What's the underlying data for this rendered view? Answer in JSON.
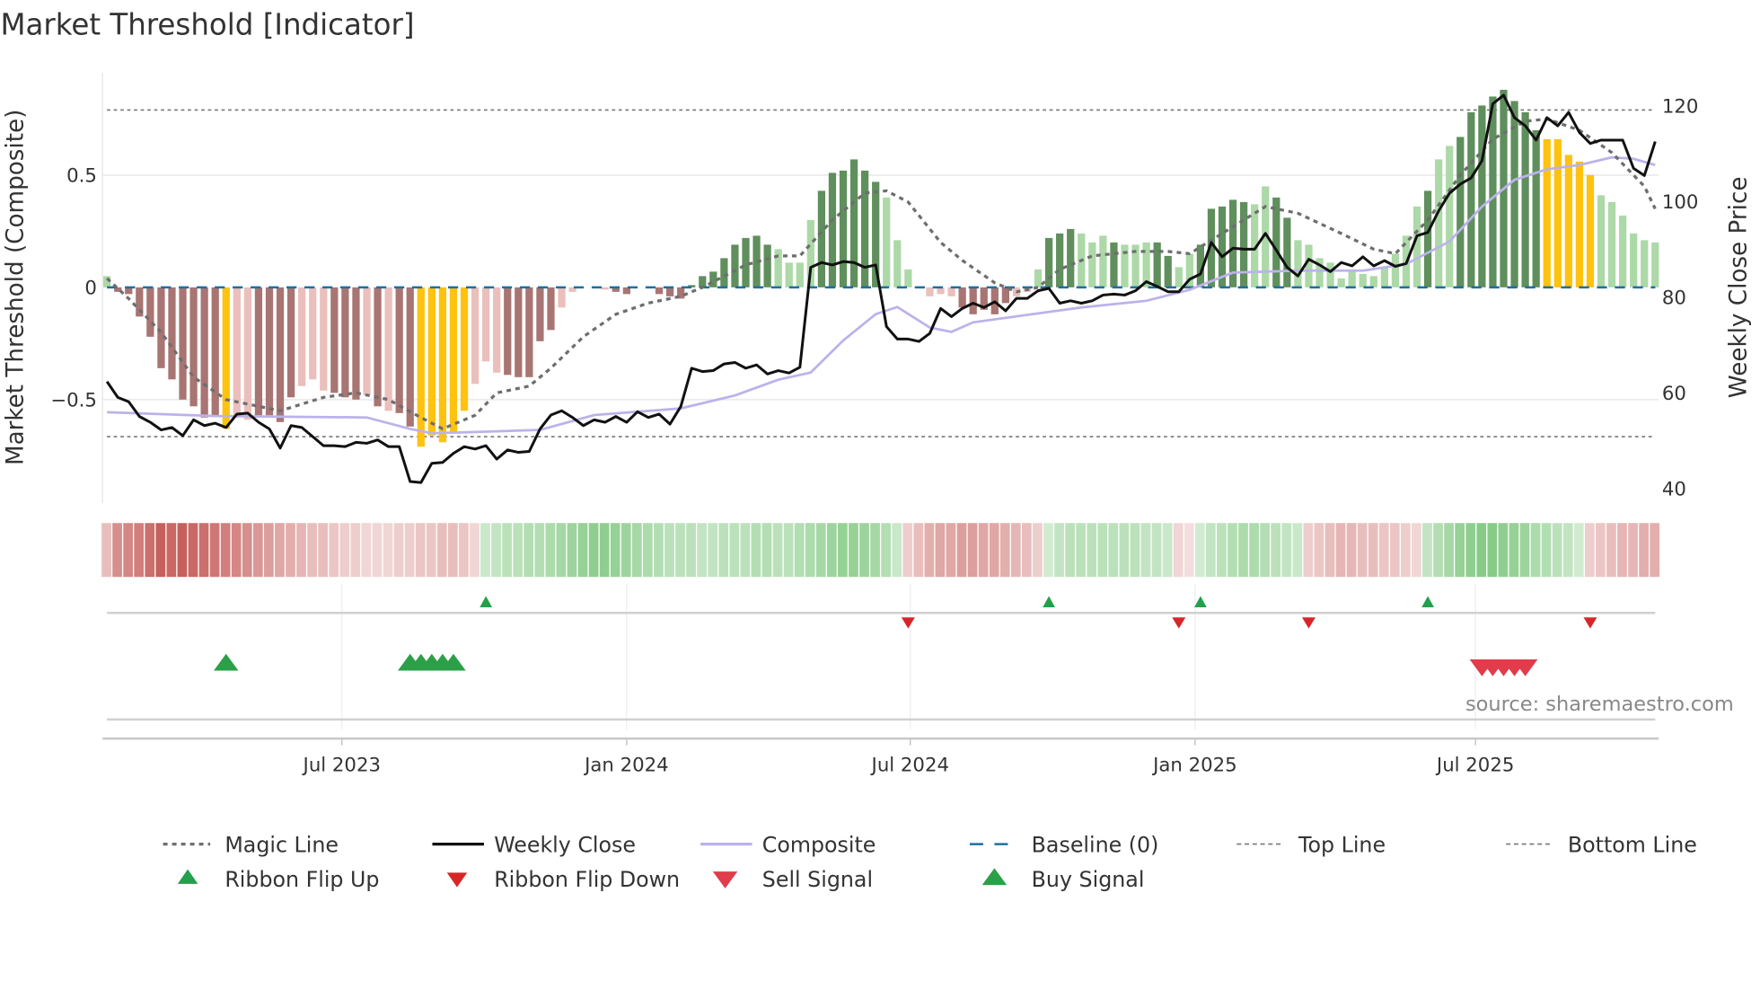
{
  "title": "Market Threshold [Indicator]",
  "source": "source: sharemaestro.com",
  "colors": {
    "bar_dark_green": "#5f8f5c",
    "bar_light_green": "#acd9a7",
    "bar_dark_red": "#a87572",
    "bar_light_red": "#ebbfbb",
    "bar_signal": "#ffc20e",
    "weekly_close": "#111111",
    "composite": "#bcb2ea",
    "magic": "#6e6e6e",
    "baseline": "#1f6f9f",
    "ribbon_red": "#c0504d",
    "ribbon_green": "#5cb85c",
    "flip_up": "#22a04b",
    "flip_down": "#d62728",
    "buy": "#2ca048",
    "sell": "#e03c4c"
  },
  "chart_data": {
    "type": "bar+line",
    "title": "Market Threshold [Indicator]",
    "ylabel_left": "Market Threshold (Composite)",
    "ylabel_right": "Weekly Close Price",
    "ylim_left": [
      -0.955,
      0.955
    ],
    "ylim_right": [
      36,
      124
    ],
    "left_ticks": [
      {
        "v": 0.5,
        "label": "0.5"
      },
      {
        "v": 0,
        "label": "0"
      },
      {
        "v": -0.5,
        "label": "−0.5"
      }
    ],
    "right_ticks": [
      {
        "v": 120,
        "label": "120"
      },
      {
        "v": 100,
        "label": "100"
      },
      {
        "v": 80,
        "label": "80"
      },
      {
        "v": 60,
        "label": "60"
      },
      {
        "v": 40,
        "label": "40"
      }
    ],
    "x_ticks": [
      {
        "week": 21.7,
        "label": "Jul 2023"
      },
      {
        "week": 48.0,
        "label": "Jan 2024"
      },
      {
        "week": 74.2,
        "label": "Jul 2024"
      },
      {
        "week": 100.5,
        "label": "Jan 2025"
      },
      {
        "week": 126.4,
        "label": "Jul 2025"
      }
    ],
    "top_line": 0.79,
    "bottom_line": -0.665,
    "baseline": 0,
    "composite_bars": [
      0.05,
      -0.02,
      -0.03,
      -0.13,
      -0.22,
      -0.36,
      -0.41,
      -0.5,
      -0.53,
      -0.58,
      -0.57,
      -0.63,
      -0.58,
      -0.59,
      -0.57,
      -0.57,
      -0.6,
      -0.49,
      -0.44,
      -0.41,
      -0.46,
      -0.47,
      -0.49,
      -0.5,
      -0.48,
      -0.53,
      -0.55,
      -0.56,
      -0.62,
      -0.71,
      -0.66,
      -0.69,
      -0.65,
      -0.55,
      -0.43,
      -0.33,
      -0.38,
      -0.39,
      -0.4,
      -0.4,
      -0.24,
      -0.19,
      -0.09,
      -0.02,
      0,
      0,
      -0.01,
      -0.02,
      -0.03,
      0,
      0,
      -0.03,
      -0.04,
      -0.05,
      0.01,
      0.05,
      0.07,
      0.13,
      0.19,
      0.22,
      0.23,
      0.19,
      0.17,
      0.11,
      0.11,
      0.3,
      0.43,
      0.51,
      0.52,
      0.57,
      0.52,
      0.47,
      0.4,
      0.21,
      0.08,
      0,
      -0.04,
      -0.03,
      -0.04,
      -0.09,
      -0.12,
      -0.1,
      -0.12,
      -0.07,
      -0.04,
      -0.02,
      0.08,
      0.22,
      0.24,
      0.26,
      0.24,
      0.2,
      0.23,
      0.2,
      0.19,
      0.19,
      0.2,
      0.2,
      0.14,
      0.09,
      0.15,
      0.19,
      0.35,
      0.36,
      0.39,
      0.38,
      0.37,
      0.45,
      0.4,
      0.31,
      0.21,
      0.19,
      0.13,
      0.11,
      0.04,
      0.08,
      0.06,
      0.05,
      0.09,
      0.15,
      0.23,
      0.36,
      0.43,
      0.57,
      0.63,
      0.67,
      0.78,
      0.81,
      0.85,
      0.88,
      0.83,
      0.78,
      0.7,
      0.66,
      0.66,
      0.59,
      0.56,
      0.5,
      0.41,
      0.38,
      0.32,
      0.24,
      0.21,
      0.2
    ],
    "bar_kind": "lddddddddddgllddddllldddldlddgggggllldddddlllllddlldddddddddddllllddddddllllllldddddllldddllldlllddlldddddllddlllllllllllldllddddddddgggggllllllllllll",
    "weekly_close": [
      62.4,
      59.1,
      58.2,
      55.1,
      53.9,
      52.3,
      52.8,
      51.1,
      54.4,
      53.2,
      53.7,
      52.8,
      55.6,
      55.8,
      53.9,
      52.5,
      48.5,
      53.2,
      52.8,
      50.9,
      49.0,
      49.0,
      48.8,
      49.7,
      49.5,
      50.2,
      48.8,
      48.8,
      41.5,
      41.3,
      45.3,
      45.5,
      47.4,
      48.8,
      48.3,
      49.0,
      46.2,
      48.1,
      47.6,
      47.8,
      52.5,
      55.4,
      56.3,
      54.9,
      53.2,
      54.4,
      53.9,
      55.1,
      53.9,
      56.1,
      54.9,
      55.6,
      53.5,
      57.2,
      65.2,
      64.5,
      64.7,
      66.1,
      66.4,
      65.2,
      65.9,
      64.0,
      64.7,
      64.2,
      65.4,
      86.3,
      87.3,
      86.8,
      87.5,
      87.3,
      86.3,
      86.8,
      73.9,
      71.3,
      71.3,
      70.8,
      72.5,
      77.7,
      76.0,
      77.7,
      78.8,
      77.9,
      79.1,
      77.2,
      79.8,
      79.8,
      81.4,
      81.9,
      78.8,
      79.3,
      78.8,
      79.3,
      80.5,
      80.7,
      80.5,
      81.4,
      83.3,
      82.3,
      81.2,
      81.2,
      83.8,
      84.9,
      91.5,
      88.5,
      90.3,
      90.1,
      90.1,
      93.4,
      89.9,
      86.3,
      84.5,
      88.0,
      86.8,
      85.4,
      87.3,
      86.6,
      88.5,
      86.6,
      87.7,
      86.5,
      87.1,
      92.9,
      93.6,
      98.1,
      101.8,
      103.7,
      105.0,
      108.6,
      120.5,
      122.3,
      117.6,
      115.9,
      112.9,
      117.6,
      115.9,
      118.7,
      114.5,
      112.2,
      112.9,
      112.9,
      112.9,
      107.0,
      105.5,
      112.6
    ],
    "composite_line": [
      [
        0,
        56.0
      ],
      [
        10,
        55.2
      ],
      [
        24,
        54.9
      ],
      [
        28,
        52.5
      ],
      [
        30,
        51.6
      ],
      [
        36,
        52.0
      ],
      [
        40,
        52.3
      ],
      [
        45,
        55.4
      ],
      [
        53,
        56.8
      ],
      [
        58,
        59.5
      ],
      [
        62,
        62.8
      ],
      [
        65,
        64.3
      ],
      [
        68,
        71.0
      ],
      [
        71,
        76.5
      ],
      [
        73,
        78.0
      ],
      [
        76,
        73.7
      ],
      [
        78,
        72.8
      ],
      [
        80,
        74.8
      ],
      [
        90,
        77.9
      ],
      [
        96,
        79.3
      ],
      [
        100,
        81.6
      ],
      [
        104,
        85.2
      ],
      [
        110,
        85.6
      ],
      [
        116,
        85.6
      ],
      [
        120,
        87.0
      ],
      [
        124,
        91.7
      ],
      [
        127,
        99.0
      ],
      [
        130,
        104.6
      ],
      [
        133,
        106.8
      ],
      [
        136,
        107.7
      ],
      [
        139,
        109.3
      ],
      [
        141,
        109.0
      ],
      [
        143,
        107.7
      ]
    ],
    "magic_line": [
      [
        0,
        0.04
      ],
      [
        2,
        -0.05
      ],
      [
        5,
        -0.2
      ],
      [
        8,
        -0.4
      ],
      [
        11,
        -0.5
      ],
      [
        14,
        -0.53
      ],
      [
        16,
        -0.55
      ],
      [
        20,
        -0.49
      ],
      [
        23,
        -0.47
      ],
      [
        26,
        -0.5
      ],
      [
        29,
        -0.58
      ],
      [
        31,
        -0.63
      ],
      [
        34,
        -0.57
      ],
      [
        36,
        -0.47
      ],
      [
        39,
        -0.44
      ],
      [
        41,
        -0.36
      ],
      [
        44,
        -0.22
      ],
      [
        47,
        -0.12
      ],
      [
        50,
        -0.07
      ],
      [
        53,
        -0.04
      ],
      [
        55,
        0.0
      ],
      [
        59,
        0.1
      ],
      [
        62,
        0.14
      ],
      [
        64,
        0.14
      ],
      [
        67,
        0.3
      ],
      [
        70,
        0.42
      ],
      [
        72,
        0.43
      ],
      [
        74,
        0.38
      ],
      [
        77,
        0.2
      ],
      [
        79,
        0.12
      ],
      [
        82,
        0.02
      ],
      [
        84,
        -0.02
      ],
      [
        86,
        0.0
      ],
      [
        88,
        0.08
      ],
      [
        91,
        0.14
      ],
      [
        95,
        0.16
      ],
      [
        98,
        0.16
      ],
      [
        100,
        0.15
      ],
      [
        103,
        0.24
      ],
      [
        107,
        0.36
      ],
      [
        110,
        0.33
      ],
      [
        114,
        0.24
      ],
      [
        117,
        0.17
      ],
      [
        119,
        0.15
      ],
      [
        122,
        0.3
      ],
      [
        125,
        0.5
      ],
      [
        128,
        0.66
      ],
      [
        131,
        0.74
      ],
      [
        133,
        0.75
      ],
      [
        136,
        0.7
      ],
      [
        139,
        0.6
      ],
      [
        142,
        0.45
      ],
      [
        143,
        0.35
      ]
    ],
    "ribbon": [
      -0.3,
      -0.6,
      -0.65,
      -0.7,
      -0.8,
      -0.9,
      -0.85,
      -0.9,
      -0.85,
      -0.8,
      -0.75,
      -0.7,
      -0.65,
      -0.6,
      -0.55,
      -0.5,
      -0.45,
      -0.4,
      -0.35,
      -0.3,
      -0.3,
      -0.25,
      -0.2,
      -0.2,
      -0.15,
      -0.15,
      -0.15,
      -0.2,
      -0.2,
      -0.25,
      -0.25,
      -0.3,
      -0.3,
      -0.25,
      -0.15,
      0.2,
      0.25,
      0.3,
      0.3,
      0.35,
      0.35,
      0.4,
      0.45,
      0.5,
      0.55,
      0.6,
      0.6,
      0.55,
      0.5,
      0.45,
      0.4,
      0.35,
      0.3,
      0.3,
      0.3,
      0.25,
      0.25,
      0.3,
      0.3,
      0.3,
      0.35,
      0.35,
      0.3,
      0.3,
      0.35,
      0.4,
      0.45,
      0.5,
      0.55,
      0.55,
      0.5,
      0.45,
      0.35,
      0.2,
      -0.2,
      -0.3,
      -0.4,
      -0.45,
      -0.45,
      -0.5,
      -0.5,
      -0.45,
      -0.45,
      -0.4,
      -0.35,
      -0.3,
      -0.2,
      0.15,
      0.25,
      0.3,
      0.3,
      0.3,
      0.3,
      0.3,
      0.3,
      0.3,
      0.25,
      0.25,
      0.2,
      -0.15,
      -0.1,
      0.15,
      0.25,
      0.3,
      0.35,
      0.4,
      0.4,
      0.35,
      0.3,
      0.25,
      0.2,
      -0.2,
      -0.25,
      -0.3,
      -0.35,
      -0.35,
      -0.3,
      -0.3,
      -0.25,
      -0.25,
      -0.2,
      -0.15,
      0.25,
      0.35,
      0.45,
      0.55,
      0.6,
      0.65,
      0.65,
      0.6,
      0.55,
      0.5,
      0.4,
      0.35,
      0.3,
      0.25,
      0.15,
      -0.2,
      -0.25,
      -0.3,
      -0.35,
      -0.35,
      -0.4,
      -0.4
    ],
    "ribbon_flip_up": [
      35,
      87,
      101,
      122
    ],
    "ribbon_flip_down": [
      74,
      99,
      111,
      137
    ],
    "buy_signals": [
      11,
      28,
      29,
      30,
      31,
      32
    ],
    "sell_signals": [
      127,
      128,
      129,
      130,
      131
    ],
    "legend": [
      {
        "key": "magic",
        "label": "Magic Line"
      },
      {
        "key": "close",
        "label": "Weekly Close"
      },
      {
        "key": "composite",
        "label": "Composite"
      },
      {
        "key": "baseline",
        "label": "Baseline (0)"
      },
      {
        "key": "top",
        "label": "Top Line"
      },
      {
        "key": "bottom",
        "label": "Bottom Line"
      },
      {
        "key": "flip_up",
        "label": "Ribbon Flip Up"
      },
      {
        "key": "flip_down",
        "label": "Ribbon Flip Down"
      },
      {
        "key": "sell",
        "label": "Sell Signal"
      },
      {
        "key": "buy",
        "label": "Buy Signal"
      }
    ],
    "legend_placement": "bottom"
  }
}
